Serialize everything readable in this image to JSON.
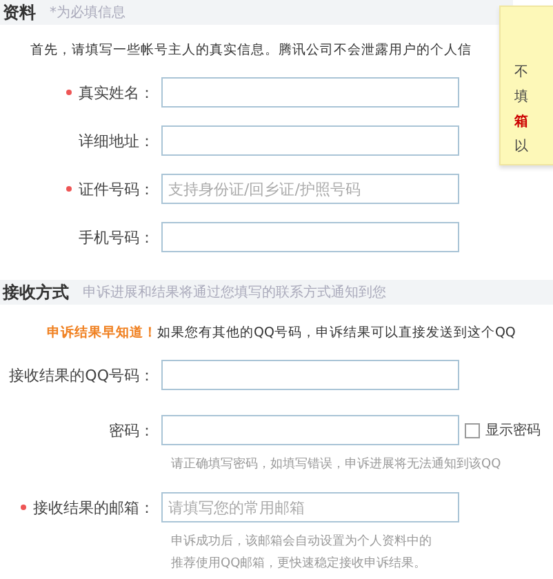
{
  "section_1": {
    "title": "资料",
    "note": "*为必填信息"
  },
  "intro": "首先，请填写一些帐号主人的真实信息。腾讯公司不会泄露用户的个人信",
  "fields_1": [
    {
      "label": "真实姓名：",
      "required": true
    },
    {
      "label": "详细地址：",
      "required": false
    },
    {
      "label": "证件号码：",
      "required": true,
      "placeholder": "支持身份证/回乡证/护照号码"
    },
    {
      "label": "手机号码：",
      "required": false
    }
  ],
  "tooltip": {
    "lines": [
      {
        "text": "不",
        "emphasis": false
      },
      {
        "text": "填",
        "emphasis": false
      },
      {
        "text": "箱",
        "emphasis": true
      },
      {
        "text": "以",
        "emphasis": false
      }
    ]
  },
  "section_2": {
    "title": "接收方式",
    "note": "申诉进展和结果将通过您填写的联系方式通知到您"
  },
  "notice": {
    "highlight": "申诉结果早知道！",
    "text": "如果您有其他的QQ号码，申诉结果可以直接发送到这个QQ"
  },
  "fields_2": [
    {
      "label": "接收结果的QQ号码：",
      "required": false
    },
    {
      "label": "密码：",
      "required": false,
      "checkbox": {
        "label": "显示密码",
        "checked": false
      },
      "hints": [
        "请正确填写密码，如填写错误，申诉进展将无法通知到该QQ"
      ]
    },
    {
      "label": "接收结果的邮箱：",
      "required": true,
      "placeholder": "请填写您的常用邮箱",
      "hints": [
        "申诉成功后，该邮箱会自动设置为个人资料中的",
        "推荐使用QQ邮箱，更快速稳定接收申诉结果。"
      ]
    }
  ]
}
